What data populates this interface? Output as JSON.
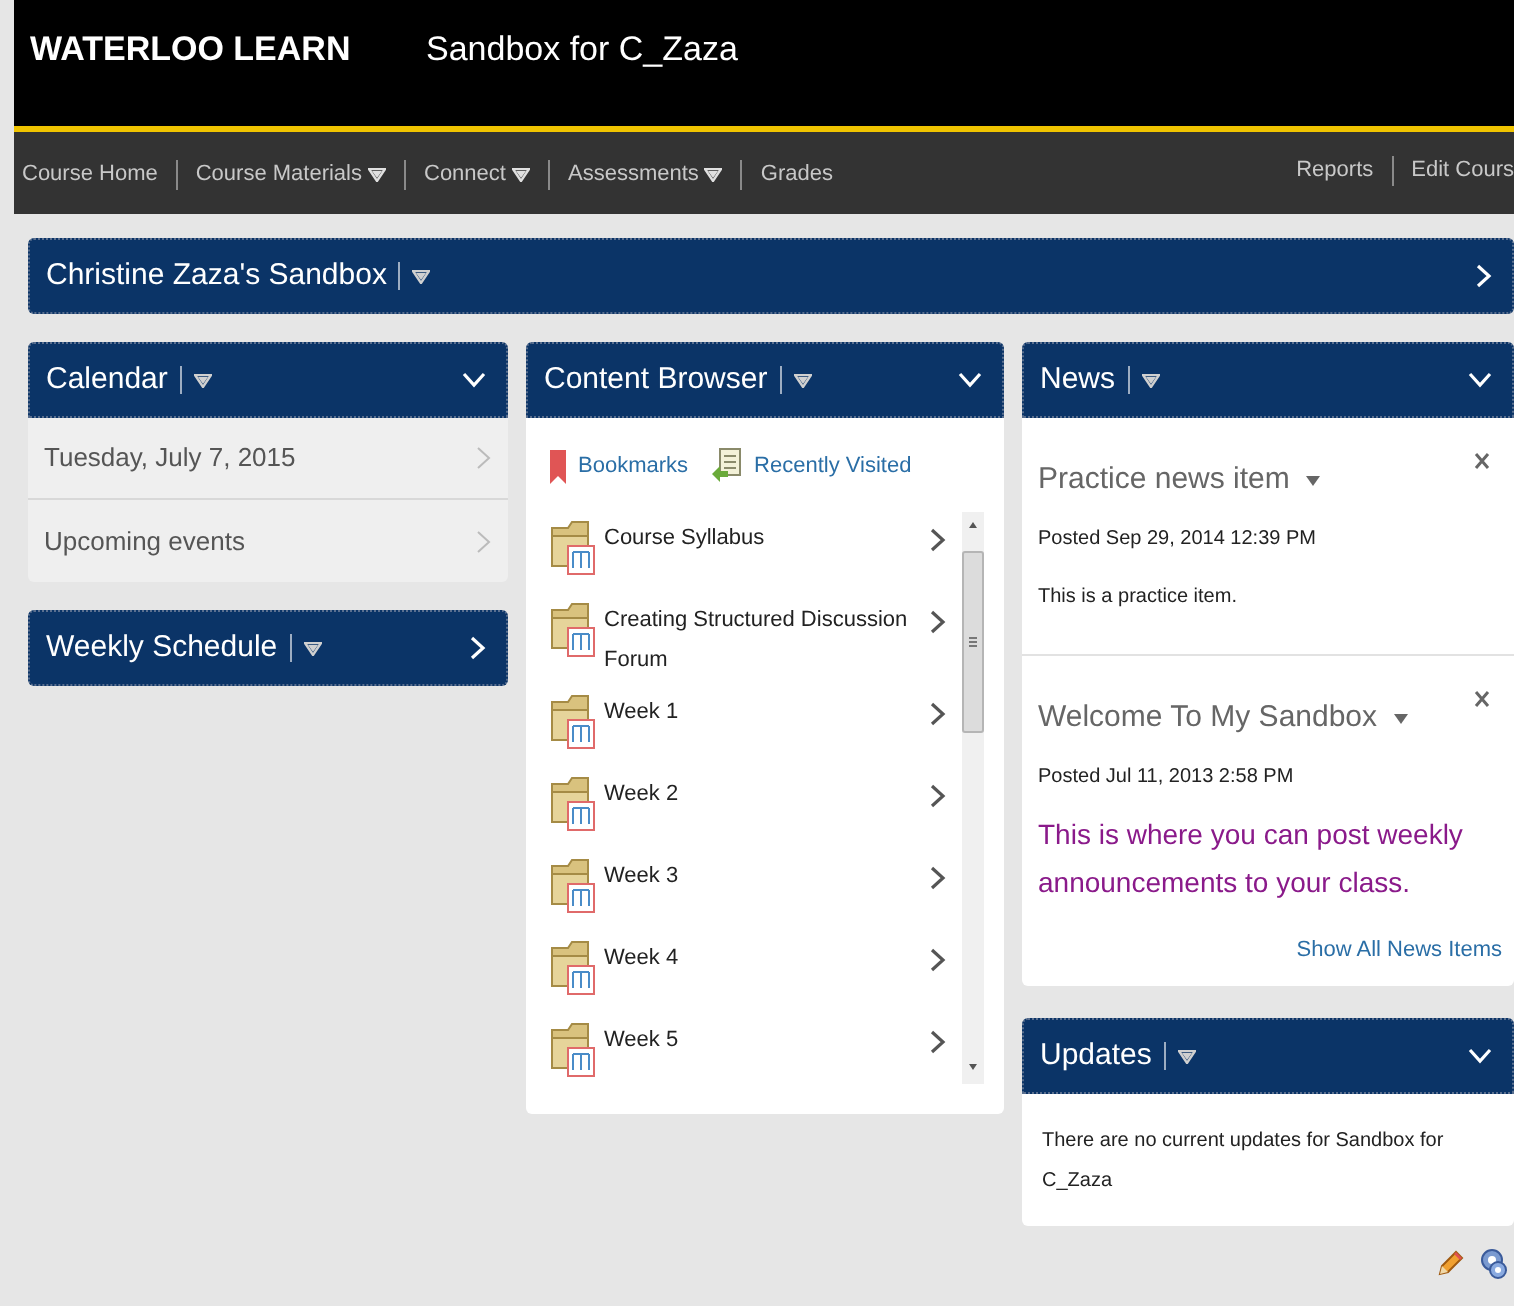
{
  "header": {
    "logo": "WATERLOO LEARN",
    "course_title": "Sandbox for C_Zaza"
  },
  "nav": {
    "left": [
      {
        "label": "Course Home",
        "has_menu": false
      },
      {
        "label": "Course Materials",
        "has_menu": true
      },
      {
        "label": "Connect",
        "has_menu": true
      },
      {
        "label": "Assessments",
        "has_menu": true
      },
      {
        "label": "Grades",
        "has_menu": false
      }
    ],
    "right": [
      {
        "label": "Reports"
      },
      {
        "label": "Edit Cours"
      }
    ]
  },
  "banner": {
    "title": "Christine Zaza's Sandbox",
    "expanded": false
  },
  "columns": [
    [
      {
        "kind": "calendar",
        "title": "Calendar",
        "expanded": true,
        "rows": [
          "Tuesday, July 7, 2015",
          "Upcoming events"
        ]
      },
      {
        "kind": "collapsed",
        "title": "Weekly Schedule",
        "expanded": false
      }
    ],
    [
      {
        "kind": "content_browser",
        "title": "Content Browser",
        "expanded": true,
        "links": [
          "Bookmarks",
          "Recently Visited"
        ],
        "items": [
          "Course Syllabus",
          "Creating Structured Discussion Forum",
          "Week 1",
          "Week 2",
          "Week 3",
          "Week 4",
          "Week 5"
        ]
      }
    ],
    [
      {
        "kind": "news",
        "title": "News",
        "expanded": true,
        "items": [
          {
            "title": "Practice news item",
            "posted": "Posted Sep 29, 2014 12:39 PM",
            "body": "This is a practice item.",
            "kind": "plain"
          },
          {
            "title": "Welcome To My Sandbox",
            "posted": "Posted Jul 11, 2013 2:58 PM",
            "body": "This is where you can post weekly announcements to your class.",
            "kind": "large"
          }
        ],
        "footer_link": "Show All News Items"
      },
      {
        "kind": "updates",
        "title": "Updates",
        "expanded": true,
        "message": "There are no current updates for Sandbox for C_Zaza"
      }
    ]
  ]
}
